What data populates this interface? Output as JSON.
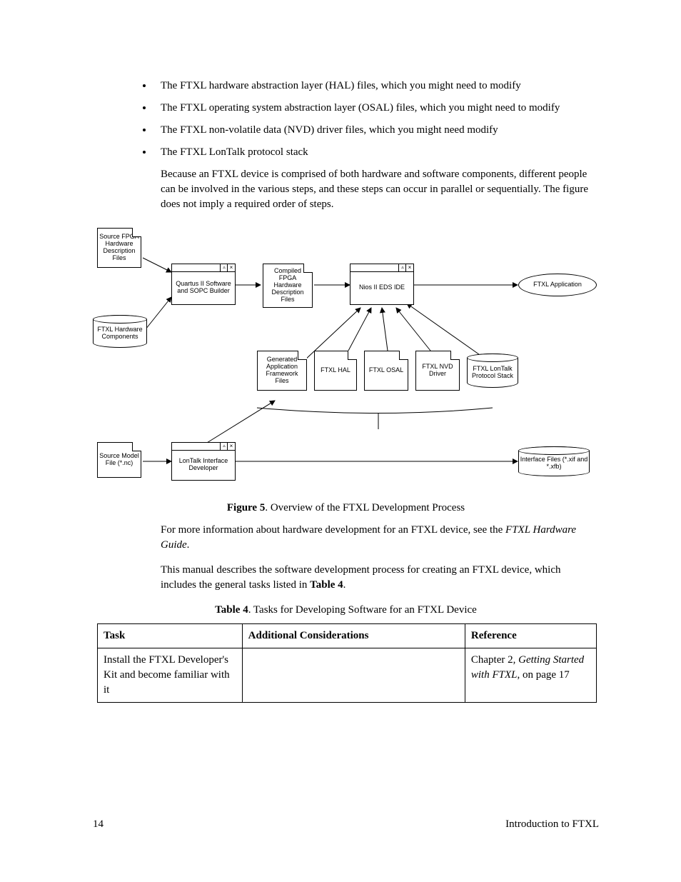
{
  "bullets": [
    "The FTXL hardware abstraction layer (HAL) files, which you might need to modify",
    "The FTXL operating system abstraction layer (OSAL) files, which you might need to modify",
    "The FTXL non-volatile data (NVD) driver files, which you might need modify",
    "The FTXL LonTalk protocol stack"
  ],
  "para1": "Because an FTXL device is comprised of both hardware and software components, different people can be involved in the various steps, and these steps can occur in parallel or sequentially.  The figure does not imply a required order of steps.",
  "figure": {
    "label": "Figure 5",
    "caption": ". Overview of the FTXL Development Process",
    "nodes": {
      "srcFpga": "Source FPGA Hardware Description Files",
      "quartus": "Quartus II Software and SOPC Builder",
      "compiled": "Compiled FPGA Hardware Description Files",
      "nios": "Nios II EDS IDE",
      "ftxlApp": "FTXL Application",
      "hwComp": "FTXL Hardware Components",
      "genFrame": "Generated Application Framework Files",
      "hal": "FTXL HAL",
      "osal": "FTXL OSAL",
      "nvd": "FTXL NVD Driver",
      "stack": "FTXL LonTalk Protocol Stack",
      "srcModel": "Source Model File (*.nc)",
      "lonDev": "LonTalk Interface Developer",
      "iface": "Interface Files (*.xif and *.xfb)"
    }
  },
  "para2_a": "For more information about hardware development for an FTXL device, see the ",
  "para2_b": "FTXL Hardware Guide",
  "para2_c": ".",
  "para3_a": "This manual describes the software development process for creating an FTXL device, which includes the general tasks listed in ",
  "para3_b": "Table 4",
  "para3_c": ".",
  "table": {
    "label": "Table 4",
    "caption": ". Tasks for Developing Software for an FTXL Device",
    "headers": {
      "task": "Task",
      "add": "Additional Considerations",
      "ref": "Reference"
    },
    "row1": {
      "task": "Install the FTXL Developer's Kit and become familiar with it",
      "add": "",
      "ref_a": "Chapter 2, ",
      "ref_b": "Getting Started with FTXL",
      "ref_c": ", on page 17"
    }
  },
  "footer": {
    "page": "14",
    "title": "Introduction to FTXL"
  }
}
